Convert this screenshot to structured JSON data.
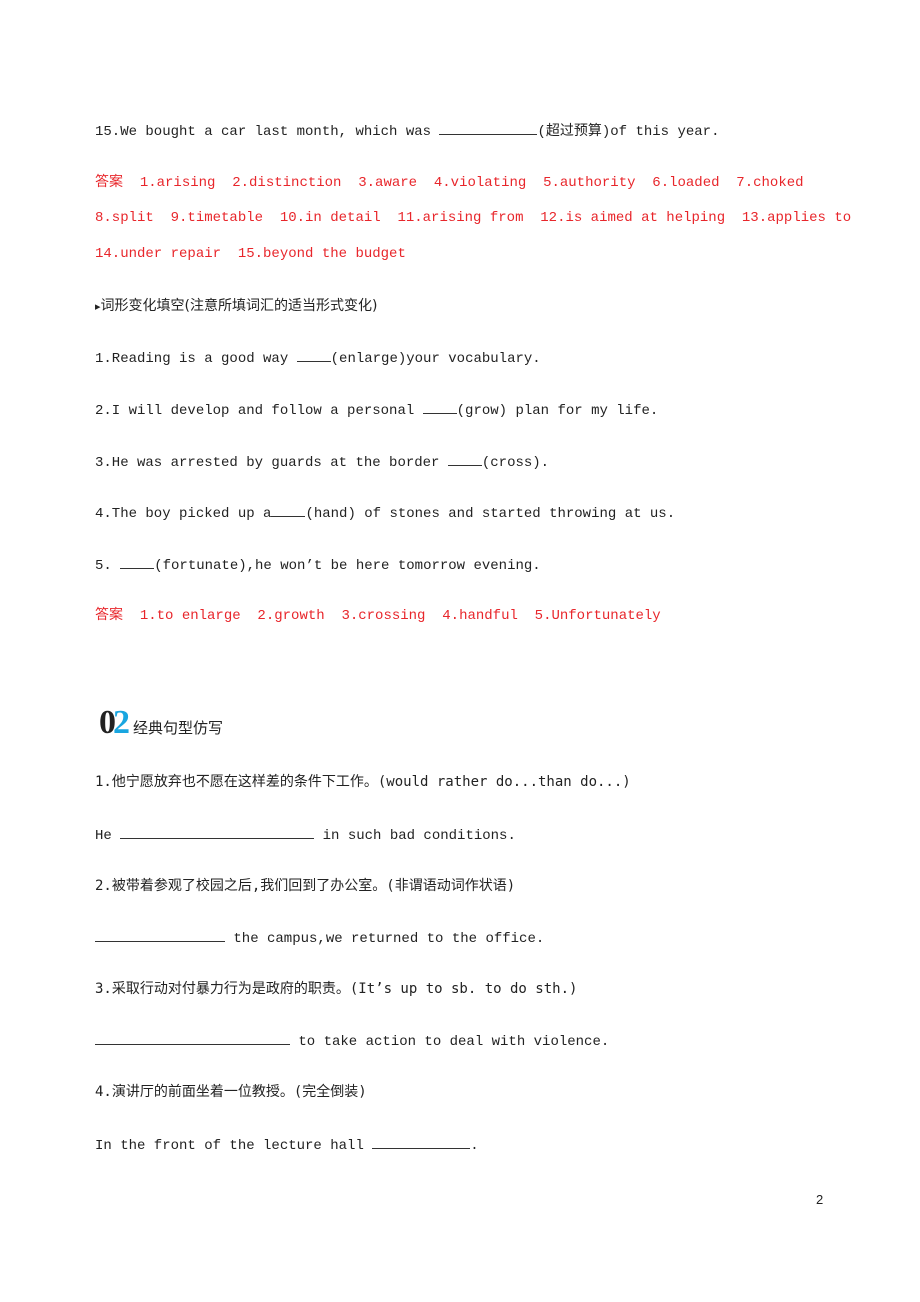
{
  "q15": {
    "pre": "15.We bought a car last month, which was ",
    "post": "(超过预算)of this year."
  },
  "answers1": {
    "label": "答案",
    "line1": "1.arising  2.distinction  3.aware  4.violating  5.authority  6.loaded  7.choked",
    "line2": "8.split  9.timetable  10.in detail  11.arising from  12.is aimed at helping  13.applies to",
    "line3": "14.under repair  15.beyond the budget"
  },
  "section_word_form": {
    "marker": "▸",
    "title": "词形变化填空(注意所填词汇的适当形式变化)",
    "items": [
      {
        "pre": "1.Reading is a good way ",
        "post": "(enlarge)your vocabulary."
      },
      {
        "pre": "2.I will develop and follow a personal ",
        "post": "(grow) plan for my life."
      },
      {
        "pre": "3.He was arrested by guards at the border ",
        "post": "(cross)."
      },
      {
        "pre": "4.The boy picked up a",
        "post": "(hand) of stones and started throwing at us."
      },
      {
        "pre": "5. ",
        "post": "(fortunate),he won’t be here tomorrow evening."
      }
    ]
  },
  "answers2": {
    "label": "答案",
    "text": "1.to enlarge  2.growth  3.crossing  4.handful  5.Unfortunately"
  },
  "section2": {
    "num_a": "0",
    "num_b": "2",
    "title": "经典句型仿写",
    "accent_color": "#19a6e0",
    "items": [
      {
        "prompt": "1.他宁愿放弃也不愿在这样差的条件下工作。(would rather do...than do...)",
        "pre": "He ",
        "post": " in such bad conditions."
      },
      {
        "prompt": "2.被带着参观了校园之后,我们回到了办公室。(非谓语动词作状语)",
        "pre": "",
        "post": " the campus,we returned to the office."
      },
      {
        "prompt": "3.采取行动对付暴力行为是政府的职责。(It’s up to sb. to do sth.)",
        "pre": "",
        "post": " to take action to deal with violence."
      },
      {
        "prompt": "4.演讲厅的前面坐着一位教授。(完全倒装)",
        "pre": "In the front of the lecture hall ",
        "post": "."
      }
    ]
  },
  "page_number": "2",
  "answer_color": "#e8262b"
}
